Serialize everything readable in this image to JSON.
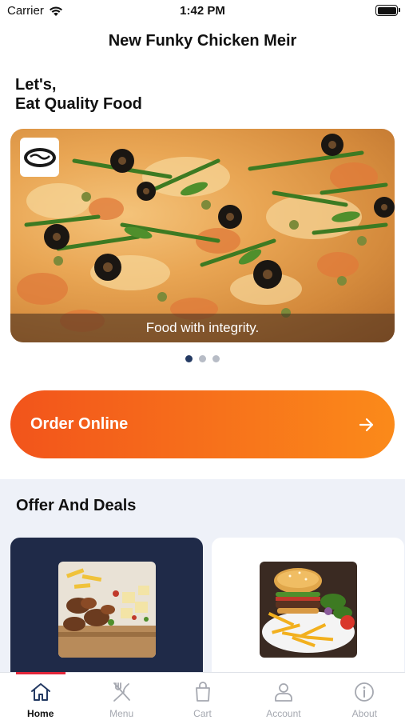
{
  "status_bar": {
    "carrier": "Carrier",
    "time": "1:42 PM",
    "battery_level": 1.0
  },
  "nav": {
    "title": "New Funky Chicken Meir"
  },
  "greeting": {
    "line1": "Let's,",
    "line2": "Eat Quality Food"
  },
  "hero": {
    "caption": "Food with integrity.",
    "logo_icon": "funky-chicken-logo-icon"
  },
  "carousel": {
    "page_count": 3,
    "active_index": 0
  },
  "order": {
    "label": "Order Online",
    "icon": "arrow-right-icon"
  },
  "offers": {
    "title": "Offer And Deals"
  },
  "tabs": [
    {
      "label": "Home",
      "icon": "home-icon",
      "active": true
    },
    {
      "label": "Menu",
      "icon": "fork-knife-icon",
      "active": false
    },
    {
      "label": "Cart",
      "icon": "shopping-bag-icon",
      "active": false
    },
    {
      "label": "Account",
      "icon": "user-icon",
      "active": false
    },
    {
      "label": "About",
      "icon": "info-icon",
      "active": false
    }
  ],
  "colors": {
    "accent": "#f2541b",
    "accent_end": "#fb8a1a",
    "navy": "#1f2a48",
    "tab_indicator": "#e3263a"
  }
}
